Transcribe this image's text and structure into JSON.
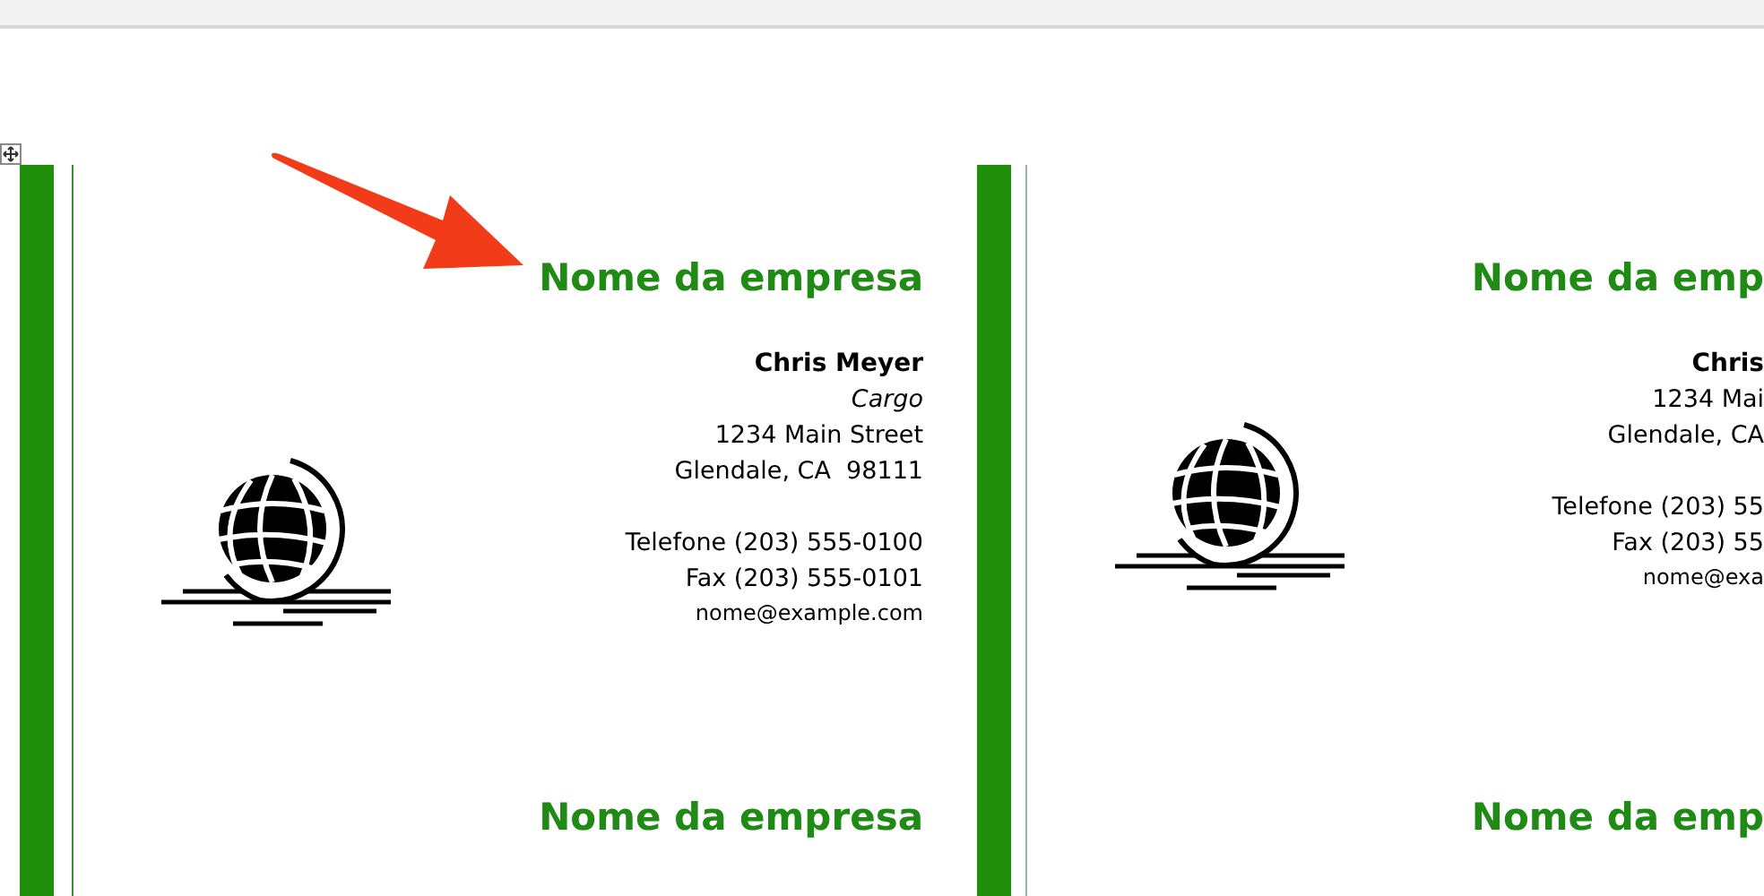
{
  "document": {
    "cards": [
      {
        "company": "Nome da empresa",
        "name": "Chris Meyer",
        "job_title": "Cargo",
        "address_lines": [
          "1234 Main Street",
          "Glendale, CA  98111"
        ],
        "phone": "Telefone (203) 555-0100",
        "fax": "Fax (203) 555-0101",
        "email": "nome@example.com",
        "logo": true
      },
      {
        "company": "Nome da emp",
        "name": "Chris",
        "address_lines": [
          "1234 Mai",
          "Glendale, CA"
        ],
        "phone": "Telefone (203) 55",
        "fax": "Fax (203) 55",
        "email": "nome@exa",
        "logo": true
      },
      {
        "company": "Nome da empresa"
      },
      {
        "company": "Nome da emp"
      }
    ]
  }
}
